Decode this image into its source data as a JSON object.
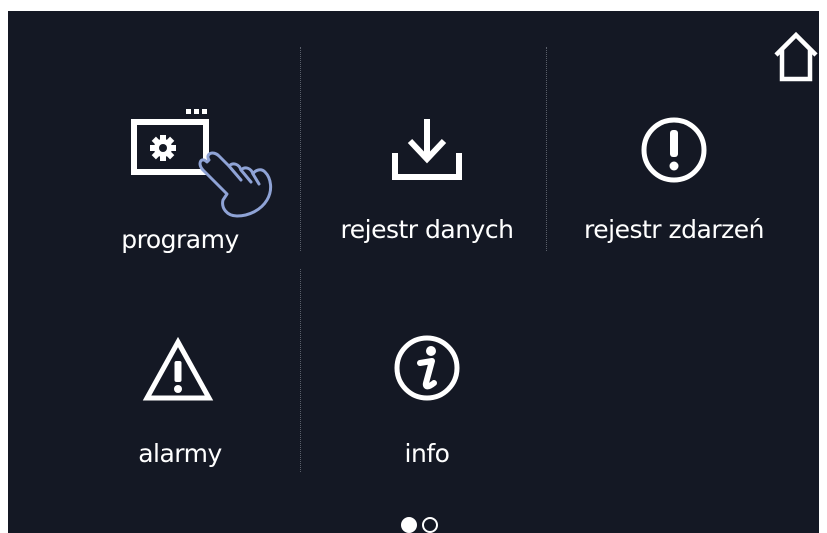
{
  "home": {
    "icon": "home-icon"
  },
  "menu": {
    "programs": {
      "label": "programy",
      "icon": "program-gear-icon"
    },
    "data_log": {
      "label": "rejestr danych",
      "icon": "download-icon"
    },
    "event_log": {
      "label": "rejestr zdarzeń",
      "icon": "exclamation-circle-icon"
    },
    "alarms": {
      "label": "alarmy",
      "icon": "warning-triangle-icon"
    },
    "info": {
      "label": "info",
      "icon": "info-circle-icon"
    }
  },
  "pointer": {
    "icon": "hand-pointer-icon"
  },
  "pagination": {
    "current_page": 1,
    "total_pages": 2
  },
  "colors": {
    "background": "#141824",
    "foreground": "#ffffff",
    "pointer_outline": "#8fa3d6",
    "divider": "#5a5f6a"
  }
}
